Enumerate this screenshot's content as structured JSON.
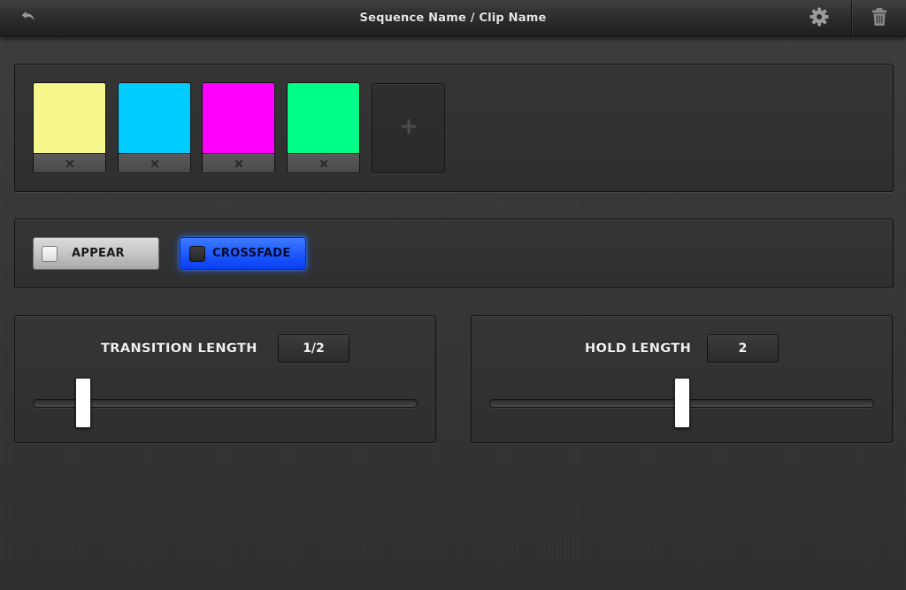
{
  "header": {
    "title": "Sequence Name / Clip Name",
    "back_icon": "undo-arrow",
    "settings_icon": "gear",
    "delete_icon": "trash"
  },
  "colors": {
    "swatches": [
      {
        "color": "#f7f88c"
      },
      {
        "color": "#00ccff"
      },
      {
        "color": "#ff00ff"
      },
      {
        "color": "#00ff88"
      }
    ],
    "remove_icon": "close-x",
    "add_label": "+"
  },
  "mode": {
    "appear": {
      "label": "APPEAR",
      "selected": false
    },
    "crossfade": {
      "label": "CROSSFADE",
      "selected": true,
      "accent": "#1f5bff"
    }
  },
  "transition_length": {
    "label": "TRANSITION LENGTH",
    "value": "1/2",
    "slider_fraction": 0.13
  },
  "hold_length": {
    "label": "HOLD LENGTH",
    "value": "2",
    "slider_fraction": 0.5
  }
}
